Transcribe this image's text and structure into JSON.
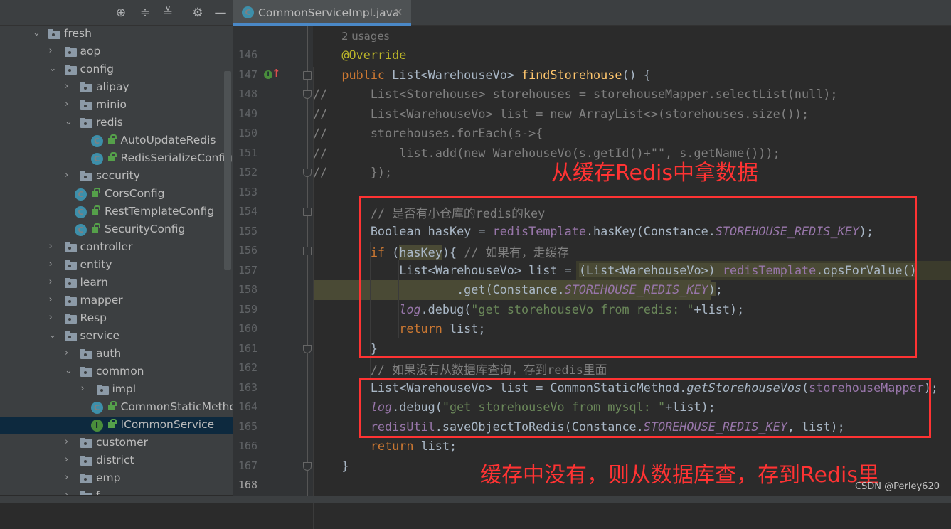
{
  "sidebar": {
    "toolbar": [
      {
        "name": "locate-icon",
        "glyph": "⊕"
      },
      {
        "name": "expand-all-icon",
        "glyph": "≑"
      },
      {
        "name": "collapse-all-icon",
        "glyph": "≚"
      },
      {
        "name": "gear-icon",
        "glyph": "⚙"
      },
      {
        "name": "hide-icon",
        "glyph": "—"
      }
    ],
    "tree": [
      {
        "label": "fresh",
        "type": "folder",
        "level": 0,
        "expanded": true
      },
      {
        "label": "aop",
        "type": "folder",
        "level": 1,
        "expanded": false
      },
      {
        "label": "config",
        "type": "folder",
        "level": 1,
        "expanded": true
      },
      {
        "label": "alipay",
        "type": "folder",
        "level": 2,
        "expanded": false
      },
      {
        "label": "minio",
        "type": "folder",
        "level": 2,
        "expanded": false
      },
      {
        "label": "redis",
        "type": "folder",
        "level": 2,
        "expanded": true
      },
      {
        "label": "AutoUpdateRedis",
        "type": "class",
        "level": 3
      },
      {
        "label": "RedisSerializeConfig",
        "type": "class",
        "level": 3
      },
      {
        "label": "security",
        "type": "folder",
        "level": 2,
        "expanded": false
      },
      {
        "label": "CorsConfig",
        "type": "class",
        "level": 2
      },
      {
        "label": "RestTemplateConfig",
        "type": "class",
        "level": 2
      },
      {
        "label": "SecurityConfig",
        "type": "class",
        "level": 2
      },
      {
        "label": "controller",
        "type": "folder",
        "level": 1,
        "expanded": false
      },
      {
        "label": "entity",
        "type": "folder",
        "level": 1,
        "expanded": false
      },
      {
        "label": "learn",
        "type": "folder",
        "level": 1,
        "expanded": false
      },
      {
        "label": "mapper",
        "type": "folder",
        "level": 1,
        "expanded": false
      },
      {
        "label": "Resp",
        "type": "folder",
        "level": 1,
        "expanded": false
      },
      {
        "label": "service",
        "type": "folder",
        "level": 1,
        "expanded": true
      },
      {
        "label": "auth",
        "type": "folder",
        "level": 2,
        "expanded": false
      },
      {
        "label": "common",
        "type": "folder",
        "level": 2,
        "expanded": true
      },
      {
        "label": "impl",
        "type": "folder",
        "level": 3,
        "expanded": false
      },
      {
        "label": "CommonStaticMethc",
        "type": "class",
        "level": 3,
        "lock": true
      },
      {
        "label": "ICommonService",
        "type": "interface",
        "level": 3,
        "lock": true,
        "selected": true
      },
      {
        "label": "customer",
        "type": "folder",
        "level": 2,
        "expanded": false
      },
      {
        "label": "district",
        "type": "folder",
        "level": 2,
        "expanded": false
      },
      {
        "label": "emp",
        "type": "folder",
        "level": 2,
        "expanded": false
      },
      {
        "label": "f...",
        "type": "folder",
        "level": 2,
        "expanded": false
      }
    ]
  },
  "tab": {
    "label": "CommonServiceImpl.java",
    "icon": "C",
    "close": "✕"
  },
  "editor": {
    "usages": "2 usages",
    "current_line": "168",
    "lines": [
      {
        "n": "146",
        "seg": [
          [
            "a",
            "    @Override"
          ]
        ]
      },
      {
        "n": "147",
        "seg": [
          [
            "k",
            "    public "
          ],
          [
            "",
            "List<WarehouseVo> "
          ],
          [
            "f",
            "findStorehouse"
          ],
          [
            "",
            "() {"
          ]
        ]
      },
      {
        "n": "148",
        "seg": [
          [
            "c",
            "//      List<Storehouse> storehouses = storehouseMapper.selectList(null);"
          ]
        ]
      },
      {
        "n": "149",
        "seg": [
          [
            "c",
            "//      List<WarehouseVo> list = new ArrayList<>(storehouses.size());"
          ]
        ]
      },
      {
        "n": "150",
        "seg": [
          [
            "c",
            "//      storehouses.forEach(s->{"
          ]
        ]
      },
      {
        "n": "151",
        "seg": [
          [
            "c",
            "//          list.add(new WarehouseVo(s.getId()+\"\", s.getName()));"
          ]
        ]
      },
      {
        "n": "152",
        "seg": [
          [
            "c",
            "//      });"
          ]
        ]
      },
      {
        "n": "153",
        "seg": []
      },
      {
        "n": "154",
        "seg": [
          [
            "c",
            "        // 是否有小仓库的redis的key"
          ]
        ]
      },
      {
        "n": "155",
        "seg": [
          [
            "",
            "        Boolean hasKey = "
          ],
          [
            "p",
            "redisTemplate"
          ],
          [
            "",
            ".hasKey(Constance."
          ],
          [
            "pi",
            "STOREHOUSE_REDIS_KEY"
          ],
          [
            "",
            ");"
          ]
        ]
      },
      {
        "n": "156",
        "seg": [
          [
            "k",
            "        if "
          ],
          [
            "",
            "("
          ],
          [
            "hl",
            "hasKey"
          ],
          [
            "",
            "){ "
          ],
          [
            "c",
            "// 如果有，走缓存"
          ]
        ]
      },
      {
        "n": "157",
        "seg": [
          [
            "",
            "            List<WarehouseVo> list = "
          ],
          [
            "hl",
            "(List<WarehouseVo>) "
          ],
          [
            "hlp",
            "redisTemplate"
          ],
          [
            "hl",
            ".opsForValue()"
          ]
        ]
      },
      {
        "n": "158",
        "seg": [
          [
            "hl",
            "                    .get(Constance."
          ],
          [
            "hlpi",
            "STOREHOUSE_REDIS_KEY"
          ],
          [
            "hl",
            ")"
          ],
          [
            "",
            ";"
          ]
        ]
      },
      {
        "n": "159",
        "seg": [
          [
            "pi",
            "            log"
          ],
          [
            "",
            ".debug("
          ],
          [
            "s",
            "\"get storehouseVo from redis: \""
          ],
          [
            "",
            "+list);"
          ]
        ]
      },
      {
        "n": "160",
        "seg": [
          [
            "k",
            "            return "
          ],
          [
            "",
            "list;"
          ]
        ]
      },
      {
        "n": "161",
        "seg": [
          [
            "",
            "        }"
          ]
        ]
      },
      {
        "n": "162",
        "seg": [
          [
            "c",
            "        // 如果没有从数据库查询，存到redis里面"
          ]
        ]
      },
      {
        "n": "163",
        "seg": [
          [
            "",
            "        List<WarehouseVo> list = CommonStaticMethod."
          ],
          [
            "it",
            "getStorehouseVos"
          ],
          [
            "",
            "("
          ],
          [
            "p",
            "storehouseMapper"
          ],
          [
            "",
            ");"
          ]
        ]
      },
      {
        "n": "164",
        "seg": [
          [
            "pi",
            "        log"
          ],
          [
            "",
            ".debug("
          ],
          [
            "s",
            "\"get storehouseVo from mysql: \""
          ],
          [
            "",
            "+list);"
          ]
        ]
      },
      {
        "n": "165",
        "seg": [
          [
            "p",
            "        redisUtil"
          ],
          [
            "",
            ".saveObjectToRedis(Constance."
          ],
          [
            "pi",
            "STOREHOUSE_REDIS_KEY"
          ],
          [
            "",
            ", list);"
          ]
        ]
      },
      {
        "n": "166",
        "seg": [
          [
            "k",
            "        return "
          ],
          [
            "",
            "list;"
          ]
        ]
      },
      {
        "n": "167",
        "seg": [
          [
            "",
            "    }"
          ]
        ]
      },
      {
        "n": "168",
        "seg": []
      }
    ]
  },
  "annotations": {
    "note1": "从缓存Redis中拿数据",
    "note2": "缓存中没有，则从数据库查，存到Redis里",
    "color": "#ff3333"
  },
  "watermark": "CSDN @Perley620"
}
